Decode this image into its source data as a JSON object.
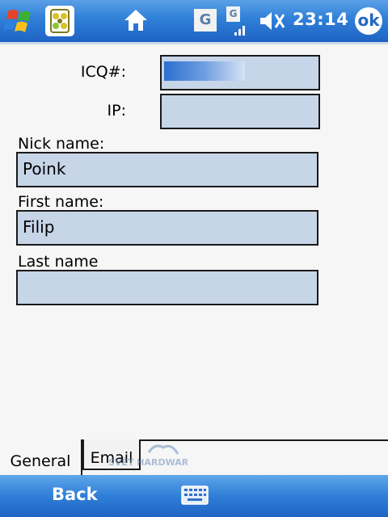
{
  "status_bar": {
    "carrier_box": "G",
    "signal_label": "G",
    "time": "23:14",
    "ok_label": "ok"
  },
  "form": {
    "icq_label": "ICQ#:",
    "icq_value": "",
    "ip_label": "IP:",
    "ip_value": "",
    "nick_label": "Nick name:",
    "nick_value": "Poink",
    "first_label": "First name:",
    "first_value": "Filip",
    "last_label": "Last name",
    "last_value": ""
  },
  "tabs": [
    {
      "label": "General",
      "active": true
    },
    {
      "label": "Email",
      "active": false
    }
  ],
  "watermark": {
    "logo": "SVĚT HARDWARE"
  },
  "bottom_bar": {
    "softkey_left": "Back"
  },
  "icons": {
    "start": "windows-flag-icon",
    "app": "icq-flower-icon",
    "home": "home-icon",
    "signal": "signal-icon",
    "volume": "volume-muted-icon",
    "keyboard": "keyboard-icon"
  }
}
